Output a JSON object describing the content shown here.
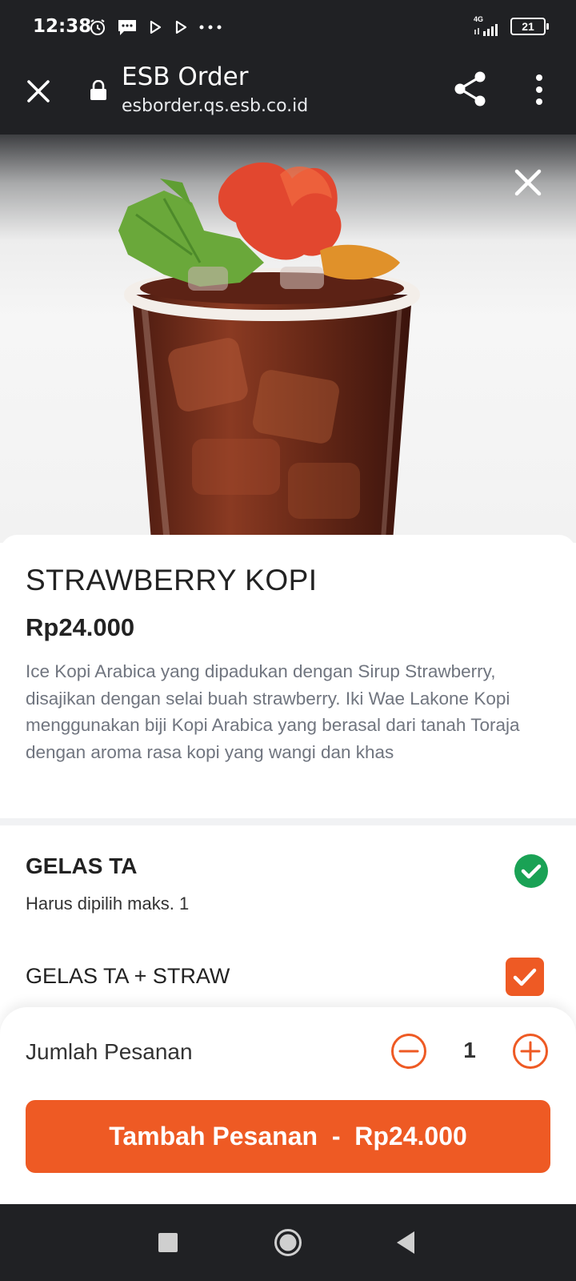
{
  "status_bar": {
    "time": "12:38",
    "network": "4G",
    "battery": "21"
  },
  "browser": {
    "title": "ESB Order",
    "url": "esborder.qs.esb.co.id"
  },
  "product": {
    "name": "STRAWBERRY KOPI",
    "price": "Rp24.000",
    "description": "Ice Kopi Arabica yang dipadukan dengan Sirup Strawberry, disajikan dengan selai buah strawberry. Iki Wae Lakone Kopi menggunakan biji Kopi Arabica yang berasal dari tanah Toraja dengan aroma rasa kopi yang wangi dan khas"
  },
  "option_group": {
    "title": "GELAS TA",
    "subtitle": "Harus dipilih maks. 1",
    "options": [
      {
        "label": "GELAS TA + STRAW",
        "selected": true
      }
    ]
  },
  "order": {
    "qty_label": "Jumlah Pesanan",
    "quantity": "1",
    "button_label": "Tambah Pesanan  -  ",
    "button_price": "Rp24.000"
  },
  "colors": {
    "accent": "#ee5a24",
    "success": "#1aa255",
    "dark_bar": "#202124"
  }
}
